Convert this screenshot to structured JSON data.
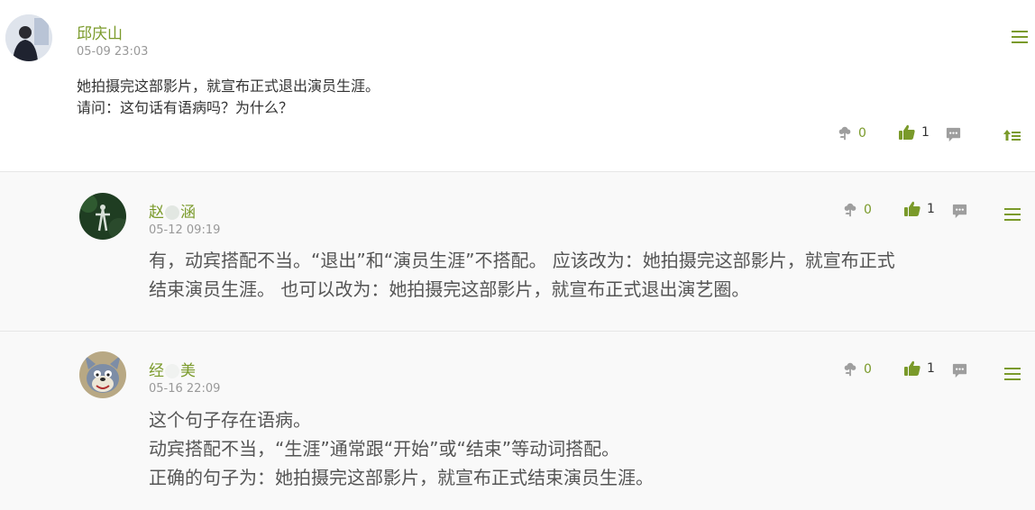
{
  "post": {
    "author": "邱庆山",
    "time": "05-09 23:03",
    "lines": [
      "她拍摄完这部影片，就宣布正式退出演员生涯。",
      "请问：这句话有语病吗？为什么？"
    ],
    "flower_count": "0",
    "like_count": "1",
    "icons": {
      "flower": "flower-icon",
      "like": "thumbs-up-icon",
      "comment": "comment-icon",
      "menu": "menu-icon",
      "top": "back-to-top-icon"
    }
  },
  "replies": [
    {
      "author_a": "赵",
      "author_b": "涵",
      "time": "05-12 09:19",
      "lines": [
        "有，动宾搭配不当。“退出”和“演员生涯”不搭配。 应该改为：她拍摄完这部影片，就宣布正式",
        "结束演员生涯。 也可以改为：她拍摄完这部影片，就宣布正式退出演艺圈。"
      ],
      "flower_count": "0",
      "like_count": "1"
    },
    {
      "author_a": "经",
      "author_b": "美",
      "time": "05-16 22:09",
      "lines": [
        "这个句子存在语病。",
        "动宾搭配不当，“生涯”通常跟“开始”或“结束”等动词搭配。",
        "正确的句子为：她拍摄完这部影片，就宣布正式结束演员生涯。"
      ],
      "flower_count": "0",
      "like_count": "1"
    }
  ],
  "colors": {
    "accent": "#7a9a2a",
    "icon_gray": "#9e9e9e"
  }
}
